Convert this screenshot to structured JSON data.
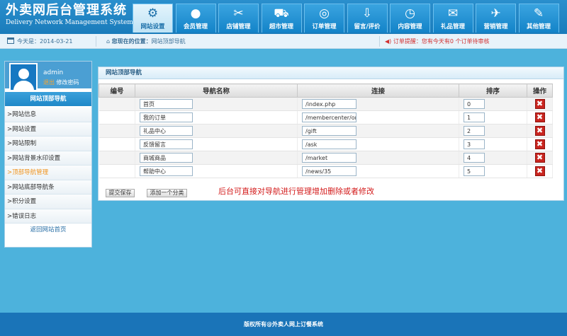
{
  "logo": {
    "title": "外卖网后台管理系统",
    "subtitle": "Delivery Network Management System"
  },
  "nav": [
    {
      "label": "网站设置",
      "icon": "gear-icon",
      "glyph": "⚙",
      "active": true
    },
    {
      "label": "会员管理",
      "icon": "user-icon",
      "glyph": "●",
      "active": false
    },
    {
      "label": "店铺管理",
      "icon": "tools-icon",
      "glyph": "✂",
      "active": false
    },
    {
      "label": "超市管理",
      "icon": "cart-icon",
      "glyph": "⛟",
      "active": false
    },
    {
      "label": "订单管理",
      "icon": "film-icon",
      "glyph": "◎",
      "active": false
    },
    {
      "label": "留言/评价",
      "icon": "download-icon",
      "glyph": "⇩",
      "active": false
    },
    {
      "label": "内容管理",
      "icon": "clock-icon",
      "glyph": "◷",
      "active": false
    },
    {
      "label": "礼品管理",
      "icon": "mail-icon",
      "glyph": "✉",
      "active": false
    },
    {
      "label": "营销管理",
      "icon": "plane-icon",
      "glyph": "✈",
      "active": false
    },
    {
      "label": "其他管理",
      "icon": "wrench-icon",
      "glyph": "✎",
      "active": false
    }
  ],
  "infobar": {
    "date": "今天是：2014-03-21",
    "location_label": "您现在的位置：",
    "location_value": "网站顶部导航",
    "alert_label": "订单提醒：",
    "alert_text": "您有今天有0 个订单待审核"
  },
  "sidebar": {
    "username": "admin",
    "logout": "退出",
    "change_password": "修改密码",
    "title": "网站顶部导航",
    "items": [
      {
        "label": ">网站信息",
        "active": false
      },
      {
        "label": ">网站设置",
        "active": false
      },
      {
        "label": ">网站限制",
        "active": false
      },
      {
        "label": ">网站背景水印设置",
        "active": false
      },
      {
        "label": ">顶部导航管理",
        "active": true
      },
      {
        "label": ">网站底部导航条",
        "active": false
      },
      {
        "label": ">积分设置",
        "active": false
      },
      {
        "label": ">错误日志",
        "active": false
      }
    ],
    "back": "返回网站首页"
  },
  "panel": {
    "title": "网站顶部导航",
    "columns": [
      "编号",
      "导航名称",
      "连接",
      "排序",
      "操作"
    ],
    "rows": [
      {
        "name": "首页",
        "link": "/index.php",
        "sort": "0"
      },
      {
        "name": "我的订单",
        "link": "/membercenter/orde",
        "sort": "1"
      },
      {
        "name": "礼品中心",
        "link": "/gift",
        "sort": "2"
      },
      {
        "name": "反馈留言",
        "link": "/ask",
        "sort": "3"
      },
      {
        "name": "商城商品",
        "link": "/market",
        "sort": "4"
      },
      {
        "name": "帮助中心",
        "link": "/news/35",
        "sort": "5"
      }
    ],
    "delete_glyph": "✖",
    "submit_label": "提交保存",
    "add_label": "添加一个分类",
    "note": "后台可直接对导航进行管理增加删除或者修改"
  },
  "footer": "版权所有@外卖人网上订餐系统",
  "colors": {
    "header": "#1a7cbb",
    "background": "#4db2dc",
    "alert": "#d23030",
    "note": "#d31b1b",
    "delete": "#c9251f"
  }
}
